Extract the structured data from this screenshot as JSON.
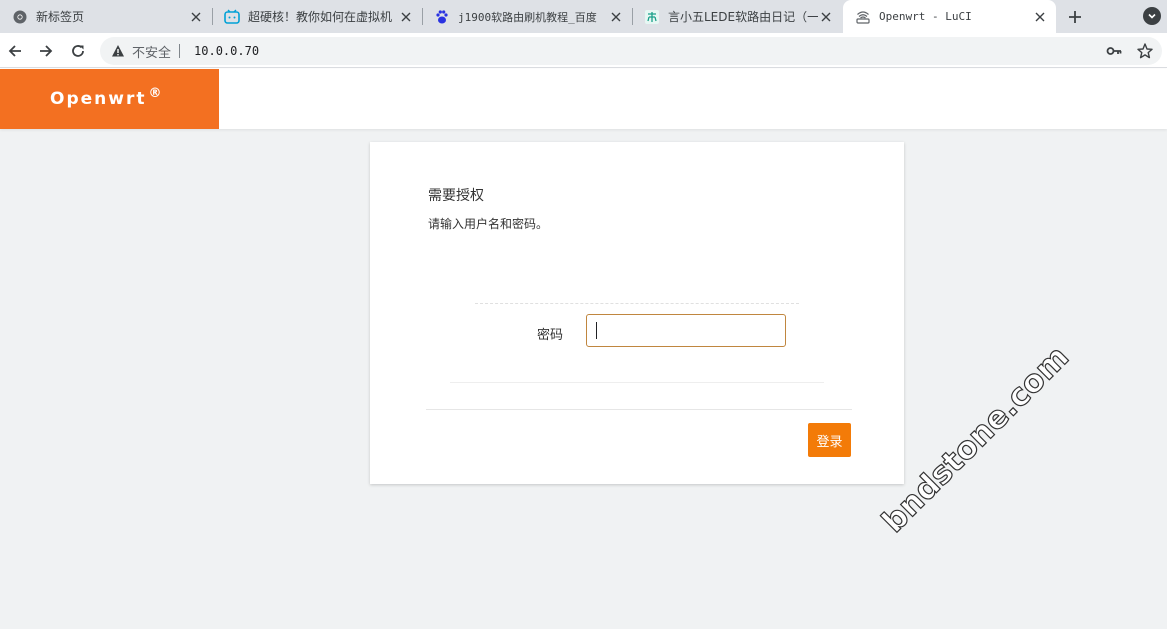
{
  "browser": {
    "tabs": [
      {
        "title": "新标签页",
        "icon": "chrome-icon",
        "active": false
      },
      {
        "title": "超硬核！教你如何在虚拟机",
        "icon": "bilibili-icon",
        "active": false
      },
      {
        "title": "j1900软路由刷机教程_百度",
        "icon": "baidu-paw-icon",
        "active": false
      },
      {
        "title": "言小五LEDE软路由日记（一",
        "icon": "site-icon",
        "active": false
      },
      {
        "title": "Openwrt - LuCI",
        "icon": "router-icon",
        "active": true
      }
    ],
    "security_label": "不安全",
    "url": "10.0.0.70"
  },
  "header": {
    "brand": "Openwrt",
    "brand_mark": "®"
  },
  "login": {
    "title": "需要授权",
    "description": "请输入用户名和密码。",
    "password_label": "密码",
    "password_value": "",
    "submit_label": "登录"
  },
  "watermark": "bndstone.com",
  "colors": {
    "brand": "#f37021",
    "button": "#f37b08",
    "page_bg": "#f0f2f3"
  }
}
